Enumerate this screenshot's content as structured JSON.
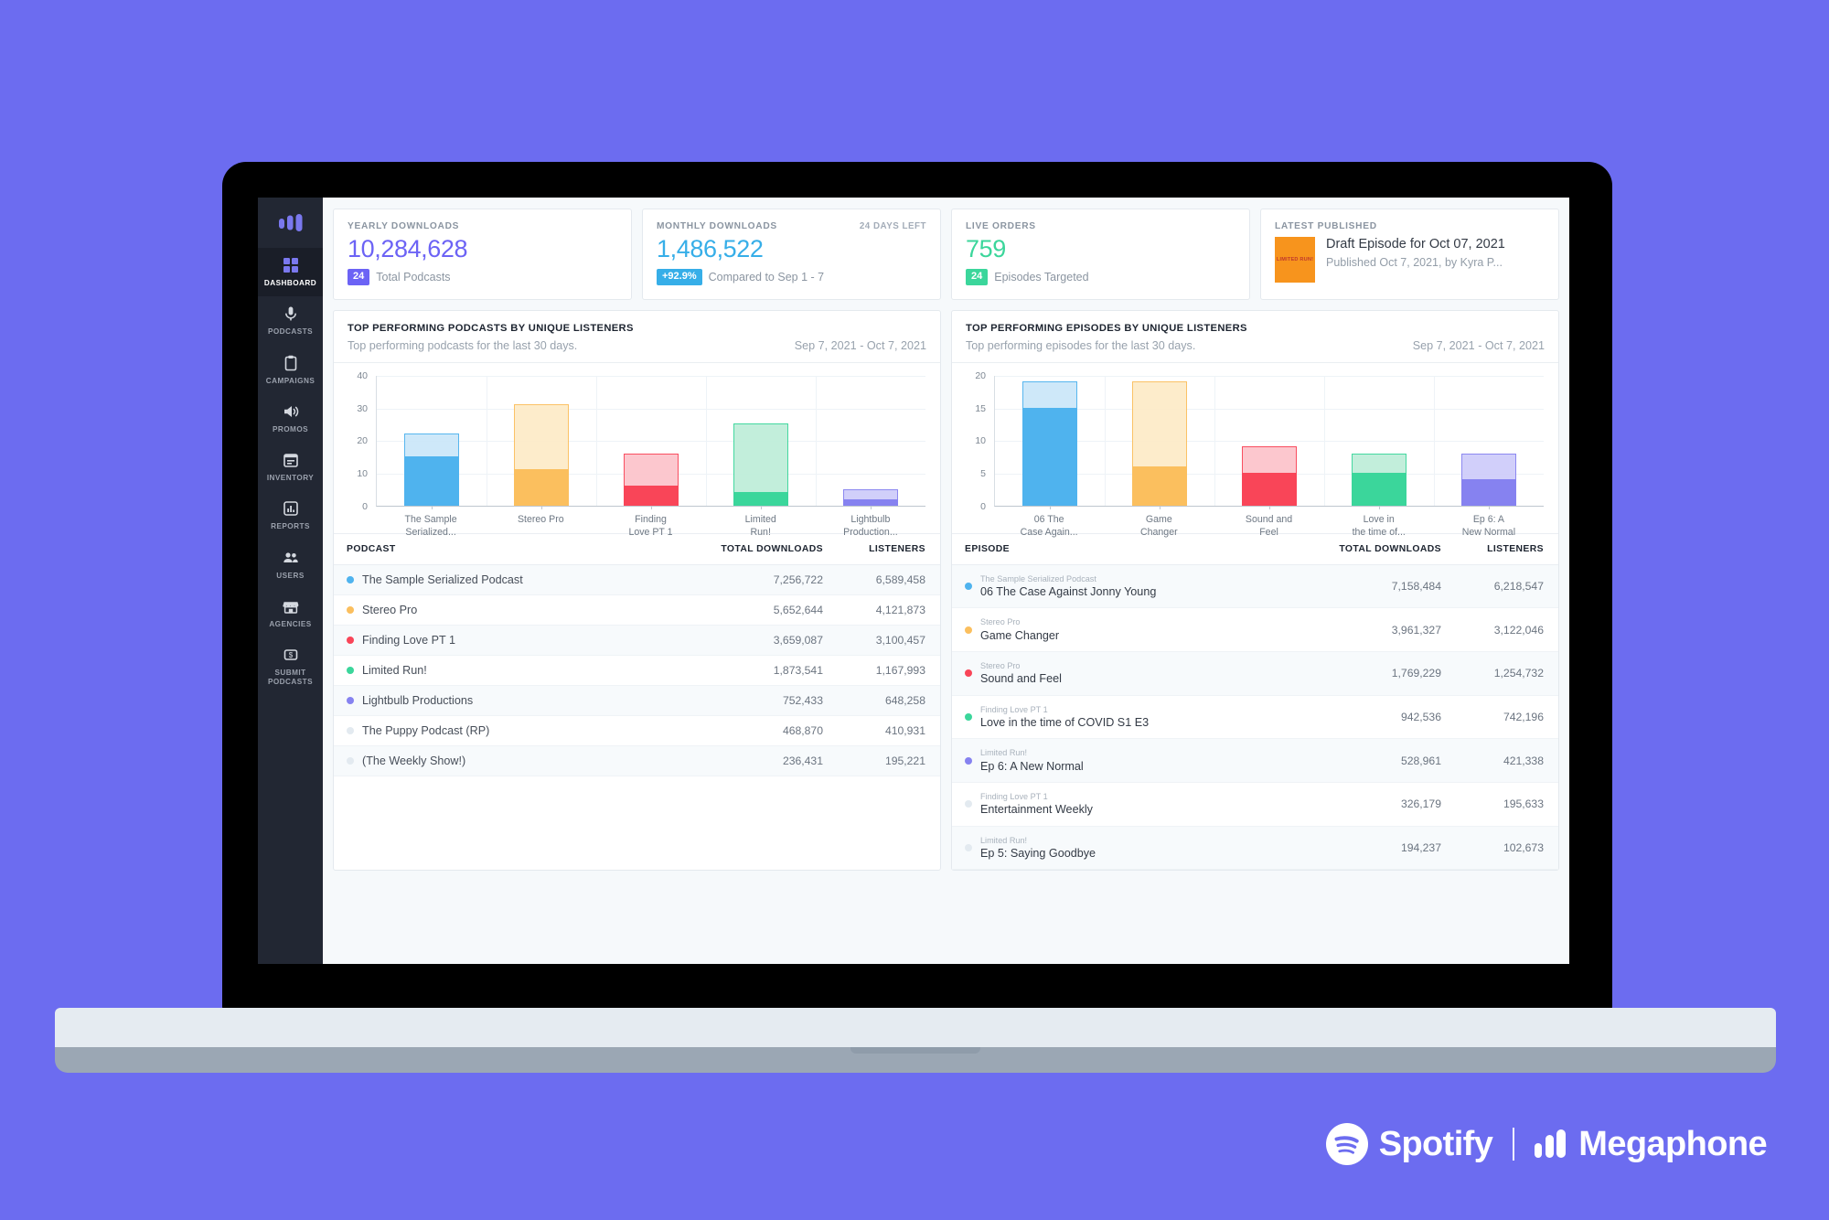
{
  "brand": {
    "background_color": "#6C6CF0",
    "spotify_label": "Spotify",
    "megaphone_label": "Megaphone",
    "registered_mark": "®"
  },
  "sidebar": {
    "logo_name": "megaphone-logo",
    "items": [
      {
        "label": "DASHBOARD",
        "icon": "grid-icon",
        "active": true
      },
      {
        "label": "PODCASTS",
        "icon": "microphone-icon",
        "active": false
      },
      {
        "label": "CAMPAIGNS",
        "icon": "clipboard-icon",
        "active": false
      },
      {
        "label": "PROMOS",
        "icon": "megaphone-speaker-icon",
        "active": false
      },
      {
        "label": "INVENTORY",
        "icon": "calendar-icon",
        "active": false
      },
      {
        "label": "REPORTS",
        "icon": "bar-chart-icon",
        "active": false
      },
      {
        "label": "USERS",
        "icon": "users-icon",
        "active": false
      },
      {
        "label": "AGENCIES",
        "icon": "storefront-icon",
        "active": false
      },
      {
        "label": "SUBMIT PODCASTS",
        "icon": "dollar-box-icon",
        "active": false
      }
    ]
  },
  "stats": {
    "yearly": {
      "title": "YEARLY DOWNLOADS",
      "value": "10,284,628",
      "value_color": "#6C63F5",
      "badge": "24",
      "badge_color": "#6C63F5",
      "foot_text": "Total Podcasts"
    },
    "monthly": {
      "title": "MONTHLY DOWNLOADS",
      "right_note": "24 DAYS LEFT",
      "value": "1,486,522",
      "value_color": "#36AEE8",
      "badge": "+92.9%",
      "badge_color": "#36AEE8",
      "foot_text": "Compared to Sep 1 - 7"
    },
    "live_orders": {
      "title": "LIVE ORDERS",
      "value": "759",
      "value_color": "#3BD69B",
      "badge": "24",
      "badge_color": "#3BD69B",
      "foot_text": "Episodes Targeted"
    },
    "latest_published": {
      "title": "LATEST PUBLISHED",
      "thumb_text": "LIMITED RUN!",
      "thumb_color": "#F7941D",
      "episode_title": "Draft Episode for Oct 07, 2021",
      "meta": "Published Oct 7, 2021, by Kyra P..."
    }
  },
  "podcasts_panel": {
    "title": "TOP PERFORMING PODCASTS BY UNIQUE LISTENERS",
    "subtitle": "Top performing podcasts for the last 30 days.",
    "date_range": "Sep 7, 2021 - Oct 7, 2021",
    "columns": {
      "name": "PODCAST",
      "downloads": "TOTAL DOWNLOADS",
      "listeners": "LISTENERS"
    },
    "rows": [
      {
        "name": "The Sample Serialized Podcast",
        "downloads": "7,256,722",
        "listeners": "6,589,458",
        "color": "#4FB3EE"
      },
      {
        "name": "Stereo Pro",
        "downloads": "5,652,644",
        "listeners": "4,121,873",
        "color": "#FBBF5E"
      },
      {
        "name": "Finding Love PT 1",
        "downloads": "3,659,087",
        "listeners": "3,100,457",
        "color": "#F94558"
      },
      {
        "name": "Limited Run!",
        "downloads": "1,873,541",
        "listeners": "1,167,993",
        "color": "#3BD69B"
      },
      {
        "name": "Lightbulb Productions",
        "downloads": "752,433",
        "listeners": "648,258",
        "color": "#8682F0"
      },
      {
        "name": "The Puppy Podcast (RP)",
        "downloads": "468,870",
        "listeners": "410,931",
        "color": "#E3EAF0"
      },
      {
        "name": "(The Weekly Show!)",
        "downloads": "236,431",
        "listeners": "195,221",
        "color": "#E3EAF0"
      }
    ]
  },
  "episodes_panel": {
    "title": "TOP PERFORMING EPISODES BY UNIQUE LISTENERS",
    "subtitle": "Top performing episodes for the last 30 days.",
    "date_range": "Sep 7, 2021 - Oct 7, 2021",
    "columns": {
      "name": "EPISODE",
      "downloads": "TOTAL DOWNLOADS",
      "listeners": "LISTENERS"
    },
    "rows": [
      {
        "show": "The Sample Serialized Podcast",
        "name": "06 The Case Against Jonny Young",
        "downloads": "7,158,484",
        "listeners": "6,218,547",
        "color": "#4FB3EE"
      },
      {
        "show": "Stereo Pro",
        "name": "Game Changer",
        "downloads": "3,961,327",
        "listeners": "3,122,046",
        "color": "#FBBF5E"
      },
      {
        "show": "Stereo Pro",
        "name": "Sound and Feel",
        "downloads": "1,769,229",
        "listeners": "1,254,732",
        "color": "#F94558"
      },
      {
        "show": "Finding Love PT 1",
        "name": "Love in the time of COVID S1 E3",
        "downloads": "942,536",
        "listeners": "742,196",
        "color": "#3BD69B"
      },
      {
        "show": "Limited Run!",
        "name": "Ep 6: A New Normal",
        "downloads": "528,961",
        "listeners": "421,338",
        "color": "#8682F0"
      },
      {
        "show": "Finding Love PT 1",
        "name": "Entertainment Weekly",
        "downloads": "326,179",
        "listeners": "195,633",
        "color": "#E3EAF0"
      },
      {
        "show": "Limited Run!",
        "name": "Ep 5: Saying Goodbye",
        "downloads": "194,237",
        "listeners": "102,673",
        "color": "#E3EAF0"
      }
    ]
  },
  "chart_data": [
    {
      "id": "podcasts-chart",
      "type": "bar",
      "title": "TOP PERFORMING PODCASTS BY UNIQUE LISTENERS",
      "xlabel": "",
      "ylabel": "",
      "ylim": [
        0,
        40
      ],
      "yticks": [
        0,
        10,
        20,
        30,
        40
      ],
      "grid": true,
      "legend": "none",
      "stacked": true,
      "categories": [
        "The Sample Serialized...",
        "Stereo Pro",
        "Finding Love PT 1",
        "Limited Run!",
        "Lightbulb Production..."
      ],
      "category_lines": [
        [
          "The Sample",
          "Serialized..."
        ],
        [
          "Stereo Pro",
          ""
        ],
        [
          "Finding",
          "Love PT 1"
        ],
        [
          "Limited",
          "Run!"
        ],
        [
          "Lightbulb",
          "Production..."
        ]
      ],
      "series": [
        {
          "name": "Unique listeners (solid)",
          "values": [
            15,
            11,
            6,
            4,
            2
          ]
        },
        {
          "name": "Remainder (light)",
          "values": [
            7,
            20,
            9.8,
            21,
            3
          ]
        }
      ],
      "totals": [
        22,
        31,
        15.8,
        25,
        5
      ],
      "colors": [
        "#4FB3EE",
        "#FBBF5E",
        "#F94558",
        "#3BD69B",
        "#8682F0"
      ],
      "light_colors": [
        "#CCE7F9",
        "#FDEBC9",
        "#FCC5CC",
        "#BFEEDA",
        "#CFCDFA"
      ]
    },
    {
      "id": "episodes-chart",
      "type": "bar",
      "title": "TOP PERFORMING EPISODES BY UNIQUE LISTENERS",
      "xlabel": "",
      "ylabel": "",
      "ylim": [
        0,
        20
      ],
      "yticks": [
        0,
        5,
        10,
        15,
        20
      ],
      "grid": true,
      "legend": "none",
      "stacked": true,
      "categories": [
        "06 The Case Again...",
        "Game Changer",
        "Sound and Feel",
        "Love in the time of...",
        "Ep 6: A New Normal"
      ],
      "category_lines": [
        [
          "06 The",
          "Case Again..."
        ],
        [
          "Game",
          "Changer"
        ],
        [
          "Sound and",
          "Feel"
        ],
        [
          "Love in",
          "the time of..."
        ],
        [
          "Ep 6: A",
          "New Normal"
        ]
      ],
      "series": [
        {
          "name": "Unique listeners (solid)",
          "values": [
            15,
            6,
            5,
            5,
            4
          ]
        },
        {
          "name": "Remainder (light)",
          "values": [
            4,
            13,
            4,
            3,
            4
          ]
        }
      ],
      "totals": [
        19,
        19,
        9,
        8,
        8
      ],
      "colors": [
        "#4FB3EE",
        "#FBBF5E",
        "#F94558",
        "#3BD69B",
        "#8682F0"
      ],
      "light_colors": [
        "#CCE7F9",
        "#FDEBC9",
        "#FCC5CC",
        "#BFEEDA",
        "#CFCDFA"
      ]
    }
  ]
}
